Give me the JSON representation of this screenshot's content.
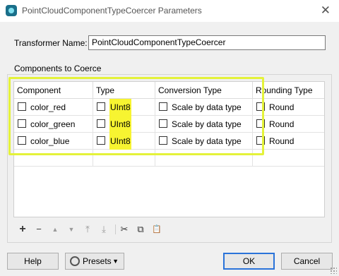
{
  "window": {
    "title": "PointCloudComponentTypeCoercer Parameters",
    "close_glyph": "✕"
  },
  "transformer": {
    "label": "Transformer Name:",
    "value": "PointCloudComponentTypeCoercer"
  },
  "group": {
    "title": "Components to Coerce",
    "columns": [
      "Component",
      "Type",
      "Conversion Type",
      "Rounding Type"
    ],
    "rows": [
      {
        "component": "color_red",
        "type": "UInt8",
        "conversion": "Scale by data type",
        "rounding": "Round"
      },
      {
        "component": "color_green",
        "type": "UInt8",
        "conversion": "Scale by data type",
        "rounding": "Round"
      },
      {
        "component": "color_blue",
        "type": "UInt8",
        "conversion": "Scale by data type",
        "rounding": "Round"
      }
    ]
  },
  "toolbar": {
    "add": "+",
    "remove": "−",
    "move_up": "▲",
    "move_down": "▼",
    "move_top": "⤒",
    "move_bottom": "⤓",
    "cut": "✂",
    "copy": "⧉",
    "paste": "📋"
  },
  "buttons": {
    "help": "Help",
    "presets": "Presets",
    "presets_arrow": "▼",
    "ok": "OK",
    "cancel": "Cancel"
  },
  "colors": {
    "highlight": "#f7f431",
    "highlight_border": "#e4f23a",
    "ok_border": "#2a73d9"
  }
}
